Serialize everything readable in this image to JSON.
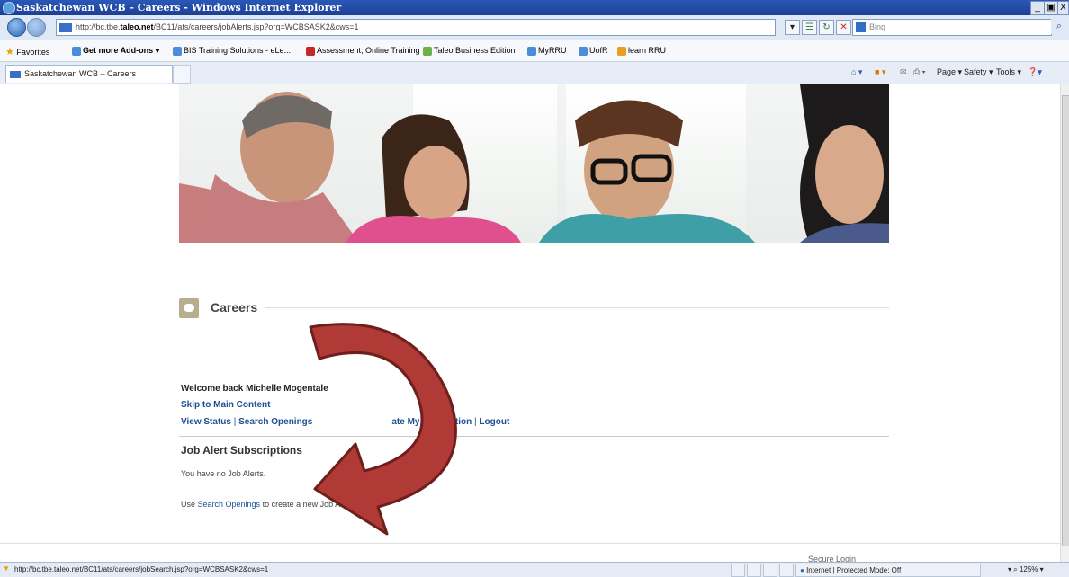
{
  "window": {
    "title": "Saskatchewan WCB – Careers - Windows Internet Explorer",
    "controls": [
      "_",
      "น",
      "X"
    ]
  },
  "address_bar": {
    "url_prefix": "http://bc.tbe.",
    "url_domain": "taleo.net",
    "url_suffix": "/BC11/ats/careers/jobAlerts.jsp?org=WCBSASK2&cws=1",
    "search_placeholder": "Bing"
  },
  "favorites_bar": {
    "favorites_label": "Favorites",
    "items": [
      "Get more Add-ons ▾",
      "BIS Training Solutions - eLe...",
      "Assessment, Online Training",
      "Taleo Business Edition",
      "MyRRU",
      "UofR",
      "learn RRU"
    ]
  },
  "tab": {
    "label": "Saskatchewan WCB – Careers"
  },
  "command_bar": {
    "page": "Page ▾",
    "safety": "Safety ▾",
    "tools": "Tools ▾"
  },
  "page": {
    "section_title": "Careers",
    "welcome": "Welcome back Michelle Mogentale",
    "skip_link": "Skip to Main Content",
    "nav": {
      "view_status": "View Status",
      "search_openings": "Search Openings",
      "sep": " | ",
      "update_info": "ate My Information",
      "logout": "Logout"
    },
    "job_alerts_title": "Job Alert Subscriptions",
    "no_alerts": "You have no Job Alerts.",
    "use_prefix": "Use ",
    "use_link": "Search Openings",
    "use_suffix": " to create a new Job Alert.",
    "secure_login": "Secure Login"
  },
  "status_bar": {
    "url": "http://bc.tbe.taleo.net/BC11/ats/careers/jobSearch.jsp?org=WCBSASK2&cws=1",
    "zone": "Internet | Protected Mode: Off",
    "zoom": "125%"
  },
  "colors": {
    "link": "#1d4f91",
    "arrow": "#b03a35",
    "titlebar": "#1d3f94"
  }
}
